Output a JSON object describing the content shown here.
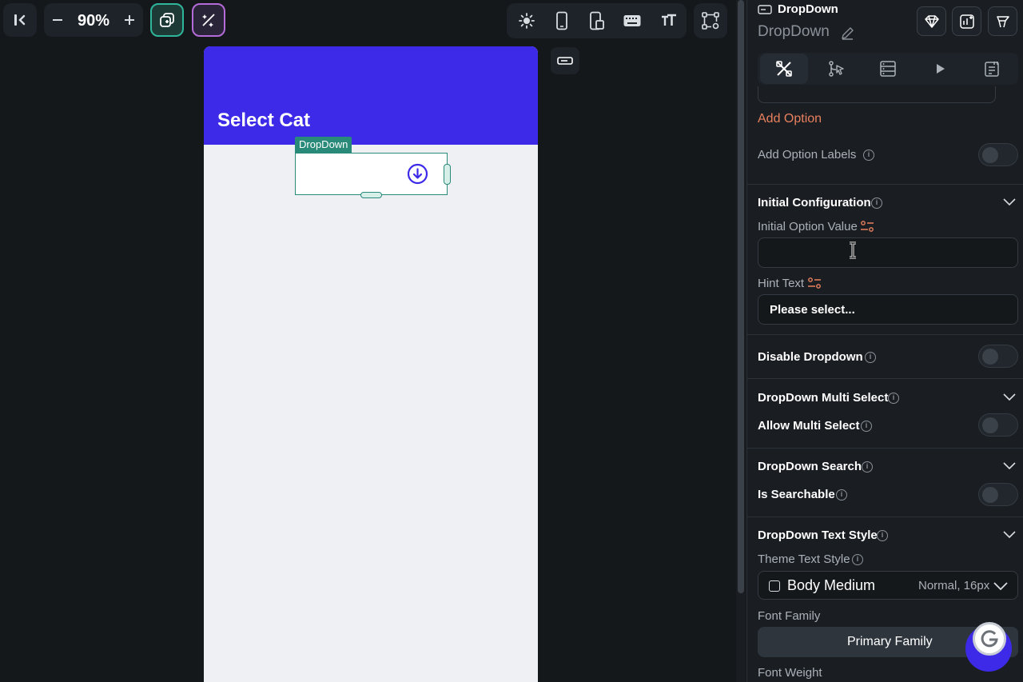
{
  "toolbar": {
    "zoom": "90%"
  },
  "canvas": {
    "appbar_title": "Select Cat",
    "dropdown_tag": "DropDown"
  },
  "panel": {
    "widget_type": "DropDown",
    "widget_name": "DropDown",
    "add_option": "Add Option",
    "add_option_labels": "Add Option Labels",
    "initial_configuration": "Initial Configuration",
    "initial_option_value": "Initial Option Value",
    "initial_option_value_input": "",
    "hint_text_label": "Hint Text",
    "hint_text_value": "Please select...",
    "disable_dropdown": "Disable Dropdown",
    "multi_select_section": "DropDown Multi Select",
    "allow_multi_select": "Allow Multi Select",
    "search_section": "DropDown Search",
    "is_searchable": "Is Searchable",
    "text_style_section": "DropDown Text Style",
    "theme_text_style": "Theme Text Style",
    "theme_style_value": "Body Medium",
    "theme_style_detail": "Normal, 16px",
    "font_family_label": "Font Family",
    "font_family_value": "Primary Family",
    "font_weight_label": "Font Weight"
  },
  "colors": {
    "appbar": "#3c2ae8",
    "selection": "#2a8a7a",
    "accent_orange": "#e9805d"
  }
}
